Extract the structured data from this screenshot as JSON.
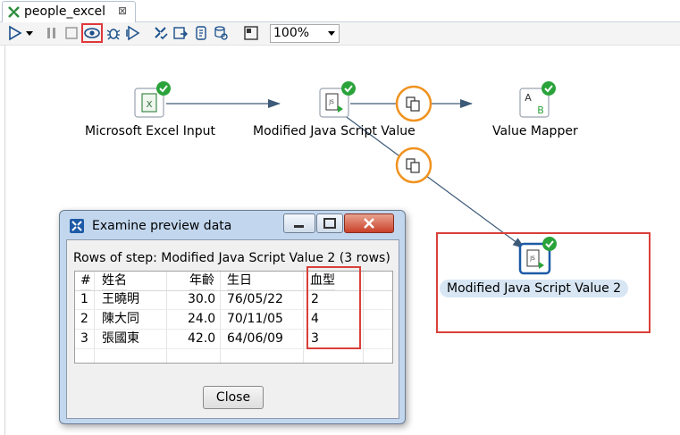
{
  "tab": {
    "title": "people_excel",
    "close_glyph": "⊠"
  },
  "toolbar": {
    "zoom": "100%",
    "buttons": [
      "run-icon",
      "run-dropdown-icon",
      "pause-icon",
      "stop-icon",
      "preview-icon",
      "debug-icon",
      "replay-icon",
      "verify-icon",
      "impact-icon",
      "sql-icon",
      "explore-db-icon",
      "show-results-icon"
    ]
  },
  "steps": {
    "excel": "Microsoft Excel Input",
    "js1": "Modified Java Script Value",
    "mapper": "Value Mapper",
    "js2": "Modified Java Script Value 2"
  },
  "dialog": {
    "title": "Examine preview data",
    "rows_label": "Rows of step: Modified Java Script Value 2 (3 rows)",
    "close_label": "Close",
    "columns": [
      "#",
      "姓名",
      "年齡",
      "生日",
      "血型"
    ],
    "rows": [
      [
        "1",
        "王曉明",
        "30.0",
        "76/05/22",
        "2"
      ],
      [
        "2",
        "陳大同",
        "24.0",
        "70/11/05",
        "4"
      ],
      [
        "3",
        "張國東",
        "42.0",
        "64/06/09",
        "3"
      ]
    ]
  },
  "colors": {
    "highlight": "#d9403a",
    "copy_ring": "#f0921e",
    "ok_badge": "#2aa33a",
    "hop": "#3d5a78"
  }
}
